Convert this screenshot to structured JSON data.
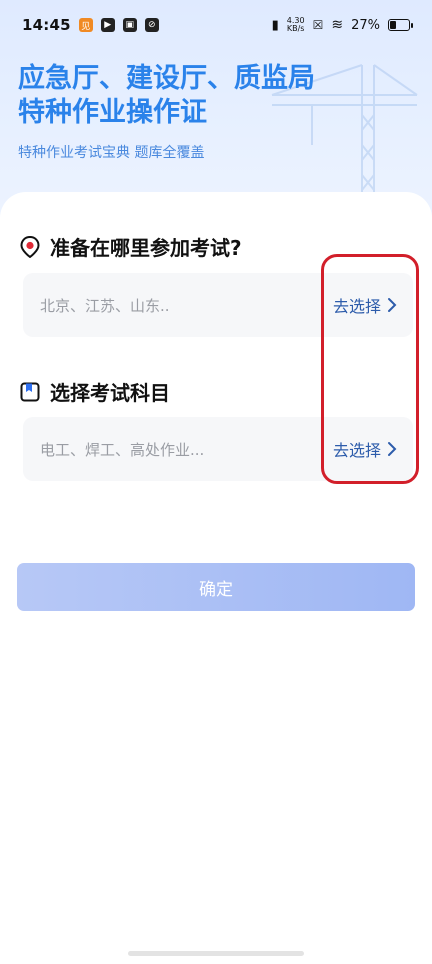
{
  "status": {
    "time": "14:45",
    "net_speed_top": "4.30",
    "net_speed_unit": "KB/s",
    "battery": "27%"
  },
  "hero": {
    "title_line1": "应急厅、建设厅、质监局",
    "title_line2": "特种作业操作证",
    "subtitle": "特种作业考试宝典 题库全覆盖"
  },
  "location": {
    "title": "准备在哪里参加考试?",
    "placeholder": "北京、江苏、山东..",
    "action": "去选择"
  },
  "subject": {
    "title": "选择考试科目",
    "placeholder": "电工、焊工、高处作业...",
    "action": "去选择"
  },
  "confirm_label": "确定",
  "colors": {
    "accent": "#2a82ea",
    "link": "#2d5cab",
    "button": "#a9bff5",
    "annotation": "#d21f2a"
  }
}
